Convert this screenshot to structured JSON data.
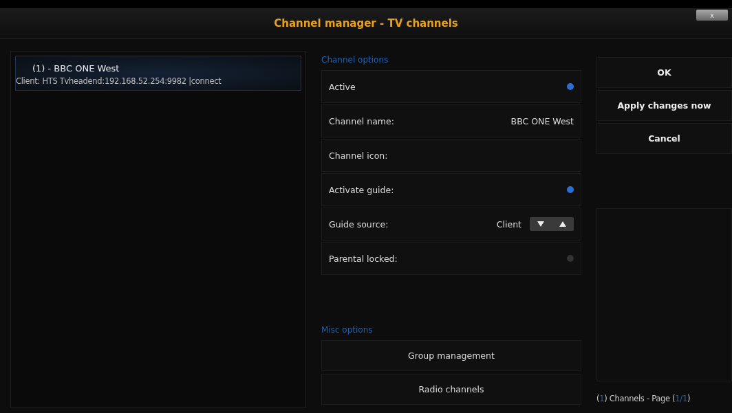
{
  "window": {
    "title": "Channel manager - TV channels",
    "close": "x"
  },
  "channels": [
    {
      "title": "(1) - BBC ONE West",
      "subtitle": "Client: HTS Tvheadend:192.168.52.254:9982 |connect",
      "selected": true
    }
  ],
  "channel_options": {
    "heading": "Channel options",
    "rows": [
      {
        "kind": "toggle",
        "label": "Active",
        "on": true
      },
      {
        "kind": "value",
        "label": "Channel name:",
        "value": "BBC ONE West"
      },
      {
        "kind": "plain",
        "label": "Channel icon:"
      },
      {
        "kind": "toggle",
        "label": "Activate guide:",
        "on": true
      },
      {
        "kind": "spinner",
        "label": "Guide source:",
        "value": "Client"
      },
      {
        "kind": "toggle",
        "label": "Parental locked:",
        "on": false
      }
    ]
  },
  "misc_options": {
    "heading": "Misc options",
    "buttons": [
      "Group management",
      "Radio channels"
    ]
  },
  "actions": [
    "OK",
    "Apply changes now",
    "Cancel"
  ],
  "footer": [
    {
      "text": "(",
      "highlight": false
    },
    {
      "text": "1",
      "highlight": true
    },
    {
      "text": ") Channels - Page (",
      "highlight": false
    },
    {
      "text": "1/1",
      "highlight": true
    },
    {
      "text": ")",
      "highlight": false
    }
  ]
}
